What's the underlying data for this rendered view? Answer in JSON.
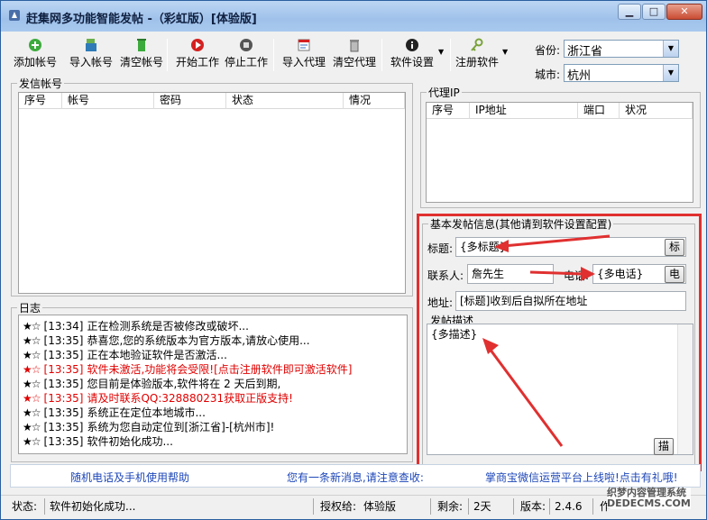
{
  "window": {
    "title": "赶集网多功能智能发帖 -（彩虹版）[体验版]",
    "min_label": "▁",
    "max_label": "□",
    "close_label": "✕"
  },
  "toolbar": {
    "add_account": "添加帐号",
    "import_account": "导入帐号",
    "clear_account": "清空帐号",
    "start": "开始工作",
    "stop": "停止工作",
    "import_proxy": "导入代理",
    "clear_proxy": "清空代理",
    "settings": "软件设置",
    "register": "注册软件"
  },
  "location": {
    "province_label": "省份:",
    "province_value": "浙江省",
    "city_label": "城市:",
    "city_value": "杭州"
  },
  "accounts": {
    "title": "发信帐号",
    "columns": [
      "序号",
      "帐号",
      "密码",
      "状态",
      "情况"
    ]
  },
  "proxy": {
    "title": "代理IP",
    "columns": [
      "序号",
      "IP地址",
      "端口",
      "状况"
    ]
  },
  "log": {
    "title": "日志",
    "entries": [
      {
        "stars": "★☆",
        "time": "[13:34]",
        "text": "正在检测系统是否被修改或破坏...",
        "color": "#000000"
      },
      {
        "stars": "★☆",
        "time": "[13:35]",
        "text": "恭喜您,您的系统版本为官方版本,请放心使用...",
        "color": "#000000"
      },
      {
        "stars": "★☆",
        "time": "[13:35]",
        "text": "正在本地验证软件是否激活...",
        "color": "#000000"
      },
      {
        "stars": "★☆",
        "time": "[13:35]",
        "text": "软件未激活,功能将会受限![点击注册软件即可激活软件]",
        "color": "#e00000"
      },
      {
        "stars": "★☆",
        "time": "[13:35]",
        "text": "您目前是体验版本,软件将在 2 天后到期,",
        "color": "#000000"
      },
      {
        "stars": "★☆",
        "time": "[13:35]",
        "text": "请及时联系QQ:328880231获取正版支持!",
        "color": "#e00000"
      },
      {
        "stars": "★☆",
        "time": "[13:35]",
        "text": "系统正在定位本地城市...",
        "color": "#000000"
      },
      {
        "stars": "★☆",
        "time": "[13:35]",
        "text": "系统为您自动定位到[浙江省]-[杭州市]!",
        "color": "#000000"
      },
      {
        "stars": "★☆",
        "time": "[13:35]",
        "text": "软件初始化成功...",
        "color": "#000000"
      }
    ]
  },
  "post_info": {
    "title": "基本发帖信息(其他请到软件设置配置)",
    "title_label": "标题:",
    "title_value": "{多标题}",
    "title_btn": "标",
    "contact_label": "联系人:",
    "contact_value": "詹先生",
    "phone_label": "电话:",
    "phone_value": "{多电话}",
    "phone_btn": "电",
    "address_label": "地址:",
    "address_value": "[标题]收到后自拟所在地址",
    "desc_title": "发帖描述",
    "desc_value": "{多描述}",
    "desc_btn": "描"
  },
  "links": {
    "help": "随机电话及手机使用帮助",
    "news": "您有一条新消息,请注意查收:",
    "ad": "掌商宝微信运营平台上线啦!点击有礼哦!"
  },
  "status": {
    "label": "状态:",
    "text": "软件初始化成功...",
    "auth_label": "授权给:",
    "auth_value": "体验版",
    "remain_label": "剩余:",
    "remain_value": "2天",
    "version_label": "版本:",
    "version_value": "2.4.6",
    "author_label": "作"
  },
  "watermark": {
    "line1": "织梦内容管理系统",
    "line2": "DEDECMS.COM"
  },
  "colors": {
    "accent_red": "#e03030",
    "link_blue": "#1e47b8",
    "log_red": "#e00000"
  }
}
